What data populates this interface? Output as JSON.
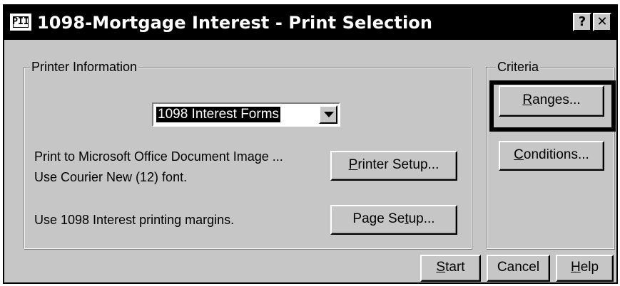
{
  "window": {
    "icon_label": "PII",
    "title": "1098-Mortgage Interest - Print Selection",
    "help_button": "?",
    "close_button": "✕"
  },
  "printer_info": {
    "legend": "Printer Information",
    "forms_select": {
      "value": "1098 Interest Forms"
    },
    "line1": "Print to Microsoft Office Document Image ...",
    "line2": "Use Courier New (12) font.",
    "line3": "Use 1098 Interest printing margins.",
    "printer_setup": {
      "pre": "",
      "hot": "P",
      "post": "rinter Setup..."
    },
    "page_setup": {
      "pre": "Page Se",
      "hot": "t",
      "post": "up..."
    }
  },
  "criteria": {
    "legend": "Criteria",
    "ranges": {
      "pre": "",
      "hot": "R",
      "post": "anges..."
    },
    "conditions": {
      "pre": "",
      "hot": "C",
      "post": "onditions..."
    }
  },
  "footer": {
    "start": {
      "pre": "",
      "hot": "S",
      "post": "tart"
    },
    "cancel": "Cancel",
    "help": {
      "pre": "",
      "hot": "H",
      "post": "elp"
    }
  }
}
